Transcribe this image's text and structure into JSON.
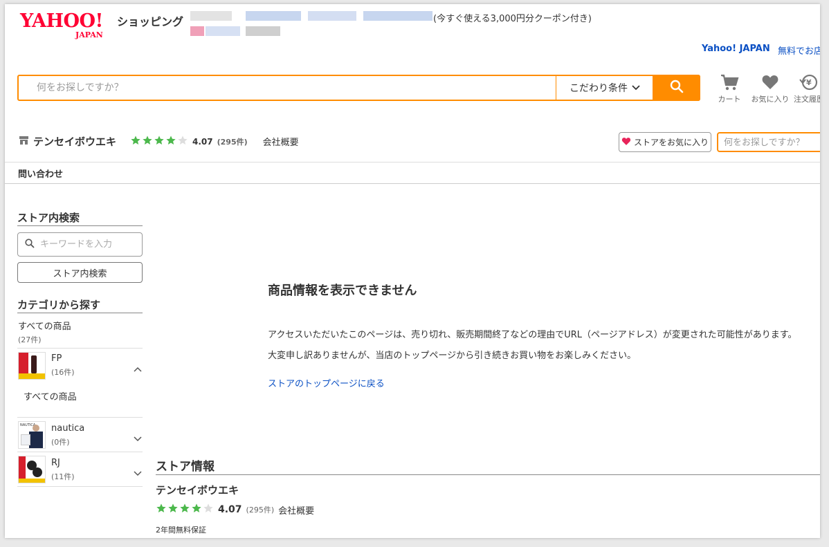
{
  "header": {
    "logo_main": "YAHOO!",
    "logo_sub": "JAPAN",
    "shopping": "ショッピング",
    "coupon_text": "(今すぐ使える3,000円分クーポン付き)",
    "yahoo_japan_link": "Yahoo! JAPAN",
    "free_link": "無料でお店"
  },
  "search": {
    "placeholder": "何をお探しですか？",
    "filter_label": "こだわり条件"
  },
  "header_icons": {
    "cart": "カート",
    "favorites": "お気に入り",
    "orders": "注文履歴"
  },
  "store": {
    "name": "テンセイボウエキ",
    "rating": "4.07",
    "review_count": "(295件)",
    "overview_link": "会社概要",
    "favorite_button": "ストアをお気に入り",
    "search_placeholder": "何をお探しですか？",
    "contact": "問い合わせ",
    "star_fill": 4
  },
  "sidebar": {
    "store_search_heading": "ストア内検索",
    "keyword_placeholder": "キーワードを入力",
    "store_search_button": "ストア内検索",
    "category_heading": "カテゴリから探す",
    "all_products": "すべての商品",
    "all_products_count": "(27件)",
    "categories": [
      {
        "label": "FP",
        "count": "(16件)",
        "sub_all": "すべての商品"
      },
      {
        "label": "nautica",
        "count": "(0件)"
      },
      {
        "label": "RJ",
        "count": "(11件)"
      }
    ]
  },
  "main": {
    "message_title": "商品情報を表示できません",
    "message_line1": "アクセスいただいたこのページは、売り切れ、販売期間終了などの理由でURL（ページアドレス）が変更された可能性があります。",
    "message_line2": "大変申し訳ありませんが、当店のトップページから引き続きお買い物をお楽しみください。",
    "back_link": "ストアのトップページに戻る"
  },
  "store_info": {
    "heading": "ストア情報",
    "name": "テンセイボウエキ",
    "rating": "4.07",
    "review_count": "(295件)",
    "overview_link": "会社概要",
    "warranty": "2年間無料保証"
  },
  "colors": {
    "accent_orange": "#ff8c00",
    "link_blue": "#0b50c4",
    "star_green": "#4cb84c",
    "logo_red": "#ff0033"
  }
}
